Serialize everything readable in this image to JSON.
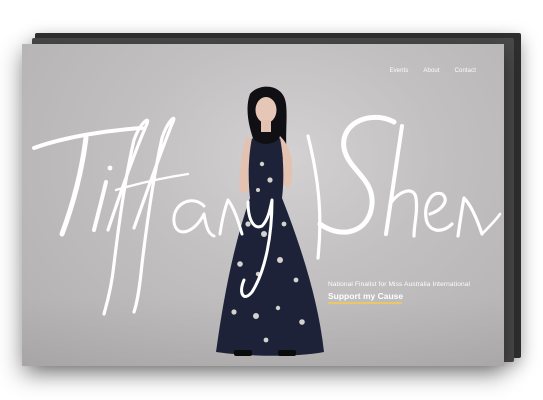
{
  "nav": {
    "items": [
      {
        "label": "Events"
      },
      {
        "label": "About"
      },
      {
        "label": "Contact"
      }
    ]
  },
  "hero": {
    "name": "Tiffany Shen",
    "tagline": "National Finalist for Miss Australia International",
    "cta_label": "Support my Cause"
  },
  "colors": {
    "backdrop": "#c2c0c1",
    "text": "#ffffff",
    "accent": "#e7c96a",
    "dress": "#1d2238"
  }
}
